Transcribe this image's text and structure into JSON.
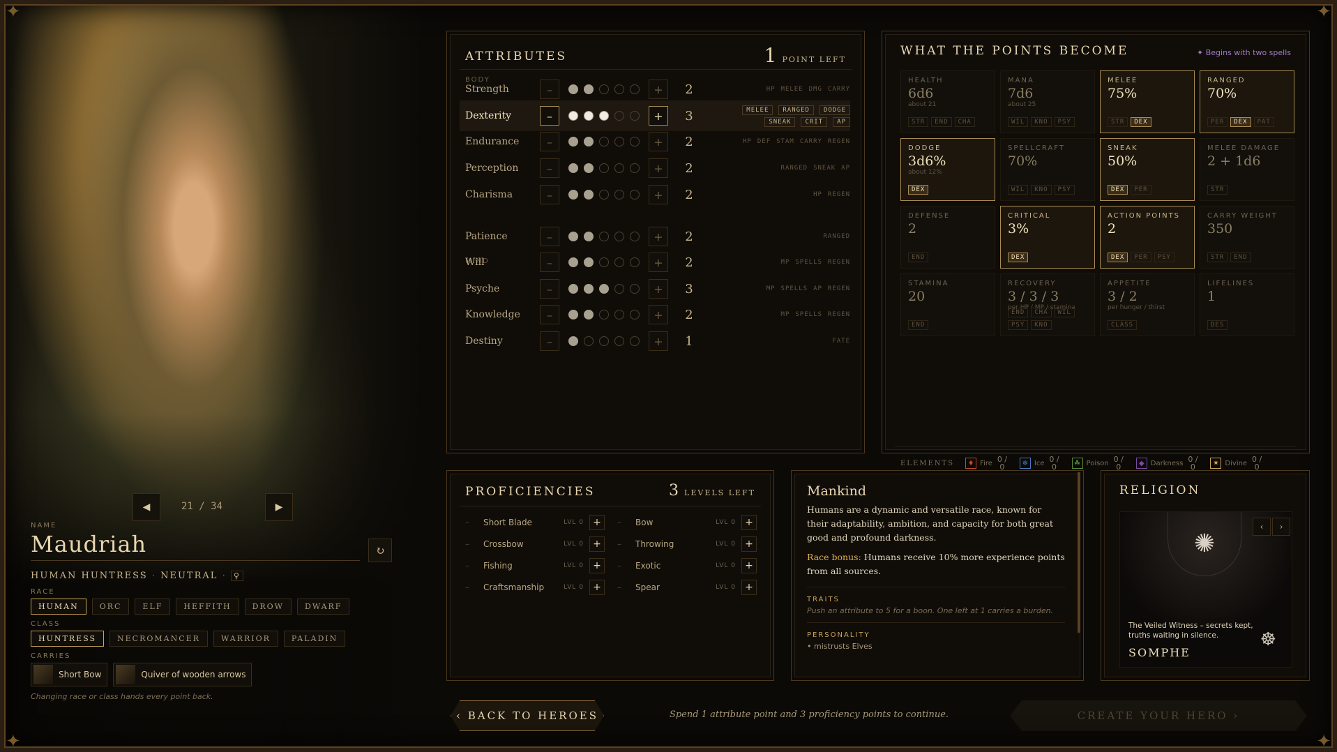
{
  "portrait": {
    "counter": "21 / 34"
  },
  "hero": {
    "name_label": "NAME",
    "name": "Maudriah",
    "subtitle": "HUMAN HUNTRESS",
    "alignment": "NEUTRAL",
    "race_label": "RACE",
    "races": [
      "HUMAN",
      "ORC",
      "ELF",
      "HEFFITH",
      "DROW",
      "DWARF"
    ],
    "class_label": "CLASS",
    "classes": [
      "HUNTRESS",
      "NECROMANCER",
      "WARRIOR",
      "PALADIN"
    ],
    "carries_label": "CARRIES",
    "carries": [
      "Short Bow",
      "Quiver of wooden arrows"
    ],
    "note": "Changing race or class hands every point back."
  },
  "attributes": {
    "title": "ATTRIBUTES",
    "points": "1",
    "points_label": "POINT LEFT",
    "body_label": "BODY",
    "mind_label": "MIND",
    "rows": [
      {
        "name": "Strength",
        "value": "2",
        "tags": [
          "HP",
          "MELEE",
          "DMG",
          "CARRY"
        ]
      },
      {
        "name": "Dexterity",
        "value": "3",
        "tags": [
          "MELEE",
          "RANGED",
          "DODGE",
          "SNEAK",
          "CRIT",
          "AP"
        ]
      },
      {
        "name": "Endurance",
        "value": "2",
        "tags": [
          "HP",
          "DEF",
          "STAM",
          "CARRY",
          "REGEN"
        ]
      },
      {
        "name": "Perception",
        "value": "2",
        "tags": [
          "RANGED",
          "SNEAK",
          "AP"
        ]
      },
      {
        "name": "Charisma",
        "value": "2",
        "tags": [
          "HP",
          "REGEN"
        ]
      },
      {
        "name": "Patience",
        "value": "2",
        "tags": [
          "RANGED"
        ]
      },
      {
        "name": "Will",
        "value": "2",
        "tags": [
          "MP",
          "SPELLS",
          "REGEN"
        ]
      },
      {
        "name": "Psyche",
        "value": "3",
        "tags": [
          "MP",
          "SPELLS",
          "AP",
          "REGEN"
        ]
      },
      {
        "name": "Knowledge",
        "value": "2",
        "tags": [
          "MP",
          "SPELLS",
          "REGEN"
        ]
      },
      {
        "name": "Destiny",
        "value": "1",
        "tags": [
          "FATE"
        ]
      }
    ],
    "dots": [
      2,
      3,
      2,
      2,
      2,
      2,
      2,
      3,
      2,
      1
    ],
    "minus": "–",
    "plus": "+"
  },
  "stats": {
    "title": "WHAT THE POINTS BECOME",
    "badge": "✦ Begins with two spells",
    "cells": [
      {
        "label": "HEALTH",
        "value": "6d6",
        "note": "about 21",
        "tags": [
          "STR",
          "END",
          "CHA"
        ],
        "on": []
      },
      {
        "label": "MANA",
        "value": "7d6",
        "note": "about 25",
        "tags": [
          "WIL",
          "KNO",
          "PSY"
        ],
        "on": []
      },
      {
        "label": "MELEE",
        "value": "75%",
        "note": "",
        "tags": [
          "STR",
          "DEX"
        ],
        "on": [
          "DEX"
        ]
      },
      {
        "label": "RANGED",
        "value": "70%",
        "note": "",
        "tags": [
          "PER",
          "DEX",
          "PAT"
        ],
        "on": [
          "DEX"
        ]
      },
      {
        "label": "DODGE",
        "value": "3d6%",
        "note": "about 12%",
        "tags": [
          "DEX"
        ],
        "on": [
          "DEX"
        ]
      },
      {
        "label": "SPELLCRAFT",
        "value": "70%",
        "note": "",
        "tags": [
          "WIL",
          "KNO",
          "PSY"
        ],
        "on": []
      },
      {
        "label": "SNEAK",
        "value": "50%",
        "note": "",
        "tags": [
          "DEX",
          "PER"
        ],
        "on": [
          "DEX"
        ]
      },
      {
        "label": "MELEE DAMAGE",
        "value": "2 + 1d6",
        "note": "",
        "tags": [
          "STR"
        ],
        "on": []
      },
      {
        "label": "DEFENSE",
        "value": "2",
        "note": "",
        "tags": [
          "END"
        ],
        "on": []
      },
      {
        "label": "CRITICAL",
        "value": "3%",
        "note": "",
        "tags": [
          "DEX"
        ],
        "on": [
          "DEX"
        ]
      },
      {
        "label": "ACTION POINTS",
        "value": "2",
        "note": "",
        "tags": [
          "DEX",
          "PER",
          "PSY"
        ],
        "on": [
          "DEX"
        ]
      },
      {
        "label": "CARRY WEIGHT",
        "value": "350",
        "note": "",
        "tags": [
          "STR",
          "END"
        ],
        "on": []
      },
      {
        "label": "STAMINA",
        "value": "20",
        "note": "",
        "tags": [
          "END"
        ],
        "on": []
      },
      {
        "label": "RECOVERY",
        "value": "3 / 3 / 3",
        "note": "per HP / MP / stamina",
        "tags": [
          "END",
          "CHA",
          "WIL",
          "PSY",
          "KNO"
        ],
        "on": []
      },
      {
        "label": "APPETITE",
        "value": "3 / 2",
        "note": "per hunger / thirst",
        "tags": [
          "CLASS"
        ],
        "on": []
      },
      {
        "label": "LIFELINES",
        "value": "1",
        "note": "",
        "tags": [
          "DES"
        ],
        "on": []
      }
    ],
    "highlight": [
      2,
      3,
      4,
      6,
      9,
      10
    ],
    "elements_label": "ELEMENTS",
    "elements": [
      {
        "name": "Fire",
        "value": "0 / 0",
        "color": "#c2462a"
      },
      {
        "name": "Ice",
        "value": "0 / 0",
        "color": "#4a7ac2"
      },
      {
        "name": "Poison",
        "value": "0 / 0",
        "color": "#5a8a3a"
      },
      {
        "name": "Darkness",
        "value": "0 / 0",
        "color": "#7a4aa2"
      },
      {
        "name": "Divine",
        "value": "0 / 0",
        "color": "#c9a35a"
      }
    ]
  },
  "proficiencies": {
    "title": "PROFICIENCIES",
    "points": "3",
    "points_label": "LEVELS LEFT",
    "lvl": "LVL 0",
    "items": [
      "Short Blade",
      "Bow",
      "Crossbow",
      "Throwing",
      "Fishing",
      "Exotic",
      "Craftsmanship",
      "Spear"
    ]
  },
  "race": {
    "title": "Mankind",
    "desc": "Humans are a dynamic and versatile race, known for their adaptability, ambition, and capacity for both great good and profound darkness.",
    "bonus_label": "Race bonus:",
    "bonus": "Humans receive 10% more experience points from all sources.",
    "traits_label": "TRAITS",
    "traits": "Push an attribute to 5 for a boon. One left at 1 carries a burden.",
    "personality_label": "PERSONALITY",
    "personality": "mistrusts Elves"
  },
  "religion": {
    "title": "RELIGION",
    "quote": "The Veiled Witness – secrets kept, truths waiting in silence.",
    "deity": "SOMPHE"
  },
  "footer": {
    "back": "‹ BACK TO HEROES",
    "hint": "Spend 1 attribute point and 3 proficiency points to continue.",
    "create": "CREATE YOUR HERO ›"
  }
}
